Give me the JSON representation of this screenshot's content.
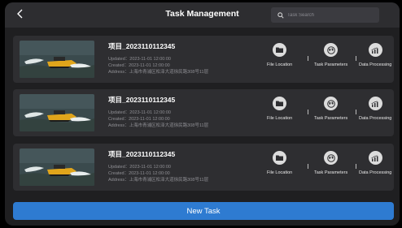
{
  "header": {
    "title": "Task Management",
    "search_placeholder": "Task Search"
  },
  "tasks": [
    {
      "name": "项目_2023110112345",
      "updated": "Updated：2023-11-01 12:00:00",
      "created": "Created：2023-11-01 12:00:00",
      "address": "Address：上海市青浦区松泽大道徐民路308号11层",
      "actions": [
        "File Location",
        "Task Parameters",
        "Data Processing"
      ]
    },
    {
      "name": "项目_2023110112345",
      "updated": "Updated：2023-11-01 12:00:00",
      "created": "Created：2023-11-01 12:00:00",
      "address": "Address：上海市青浦区松泽大道徐民路308号11层",
      "actions": [
        "File Location",
        "Task Parameters",
        "Data Processing"
      ]
    },
    {
      "name": "项目_2023110112345",
      "updated": "Updated：2023-11-01 12:00:00",
      "created": "Created：2023-11-01 12:00:00",
      "address": "Address：上海市青浦区松泽大道徐民路308号11层",
      "actions": [
        "File Location",
        "Task Parameters",
        "Data Processing"
      ]
    }
  ],
  "new_task_label": "New Task",
  "icons": {
    "back": "chevron-left-icon",
    "search": "search-icon",
    "file": "folder-icon",
    "params": "globe-icon",
    "data": "chart-icon"
  },
  "colors": {
    "background": "#1f1f21",
    "card": "#2e2e31",
    "primary_button": "#2e7bd1",
    "action_circle": "#dcdcdc"
  }
}
